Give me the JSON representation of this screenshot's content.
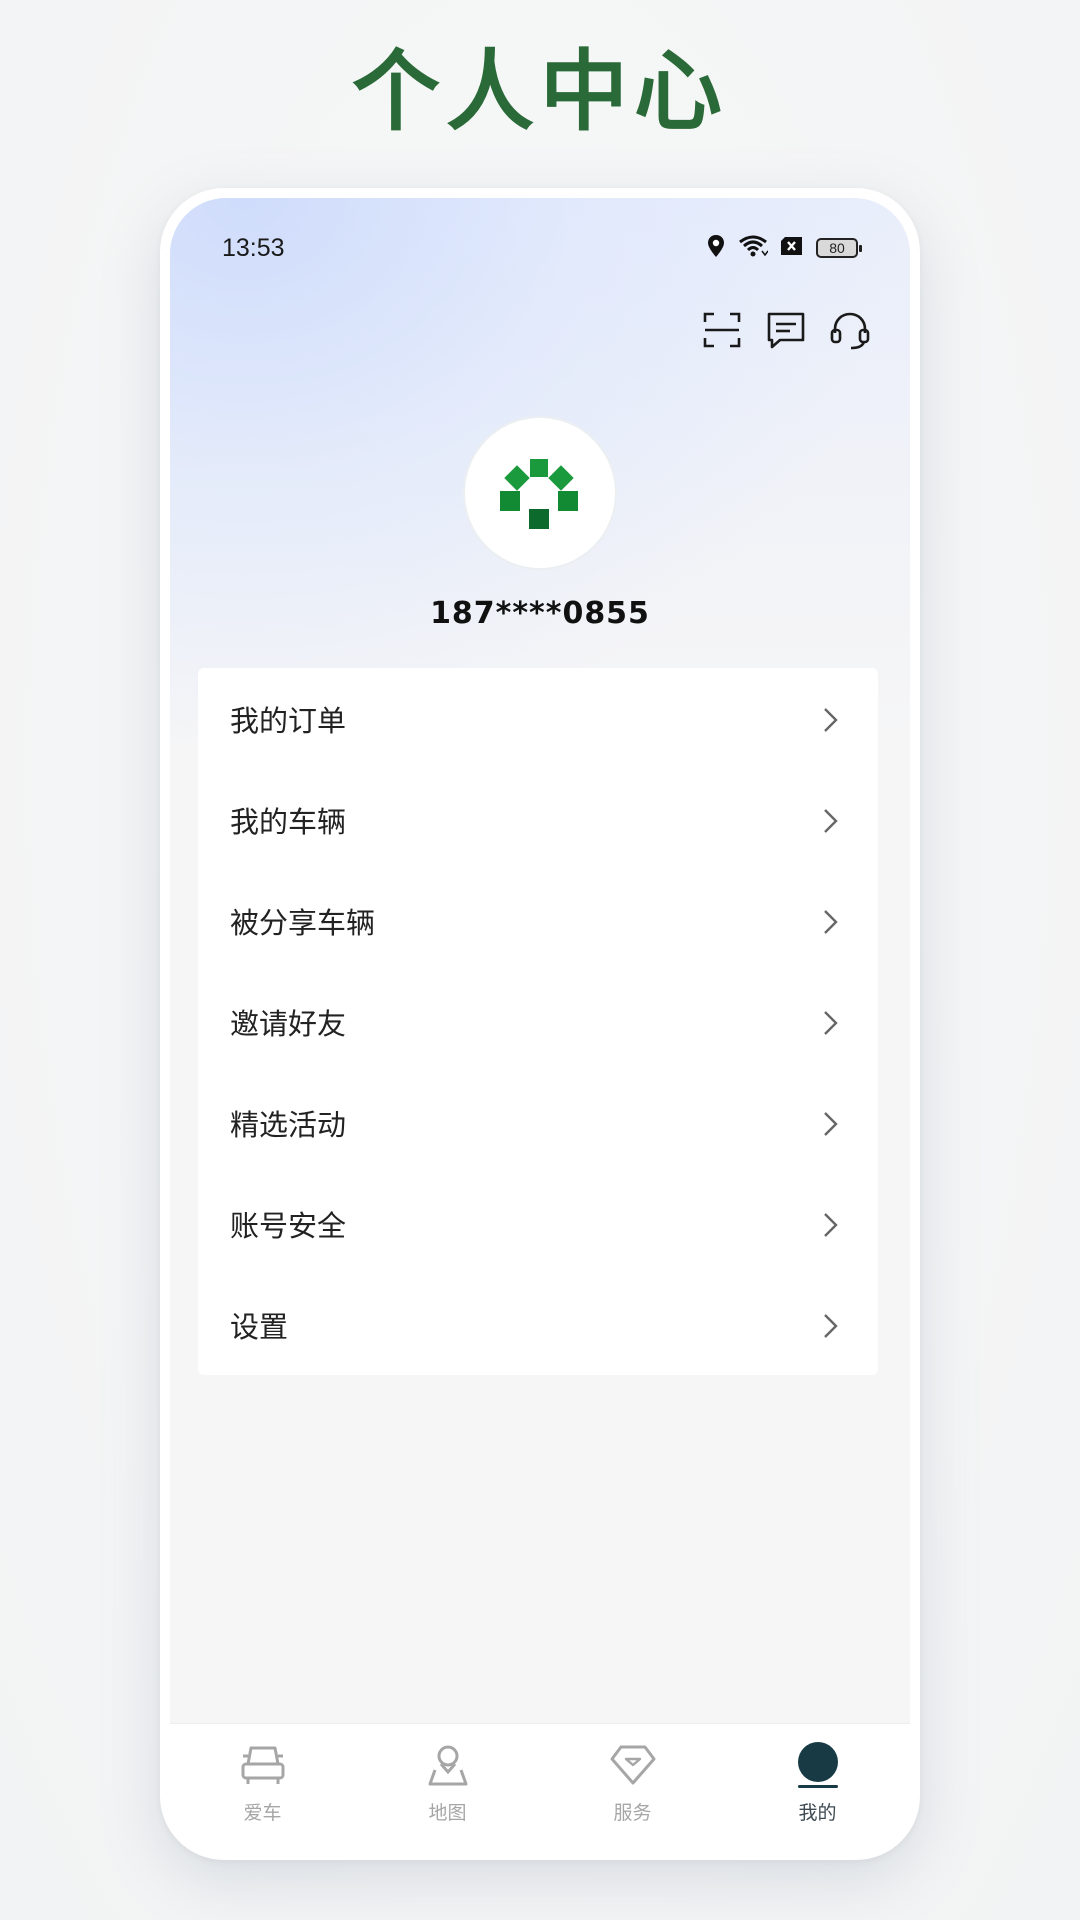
{
  "page_title": "个人中心",
  "status": {
    "time": "13:53",
    "battery": "80"
  },
  "header_actions": [
    {
      "icon": "scan-icon"
    },
    {
      "icon": "message-icon"
    },
    {
      "icon": "headset-icon"
    }
  ],
  "profile": {
    "phone": "187****0855",
    "logo_color": "#1f8f3a"
  },
  "menu": [
    {
      "label": "我的订单"
    },
    {
      "label": "我的车辆"
    },
    {
      "label": "被分享车辆"
    },
    {
      "label": "邀请好友"
    },
    {
      "label": "精选活动"
    },
    {
      "label": "账号安全"
    },
    {
      "label": "设置"
    }
  ],
  "tabs": [
    {
      "label": "爱车",
      "icon": "car-icon",
      "active": false
    },
    {
      "label": "地图",
      "icon": "map-pin-icon",
      "active": false
    },
    {
      "label": "服务",
      "icon": "diamond-icon",
      "active": false
    },
    {
      "label": "我的",
      "icon": "person-icon",
      "active": true
    }
  ],
  "colors": {
    "title_green": "#2a6a38",
    "active_tab": "#173a45",
    "inactive_tab": "#a6a6a6"
  }
}
